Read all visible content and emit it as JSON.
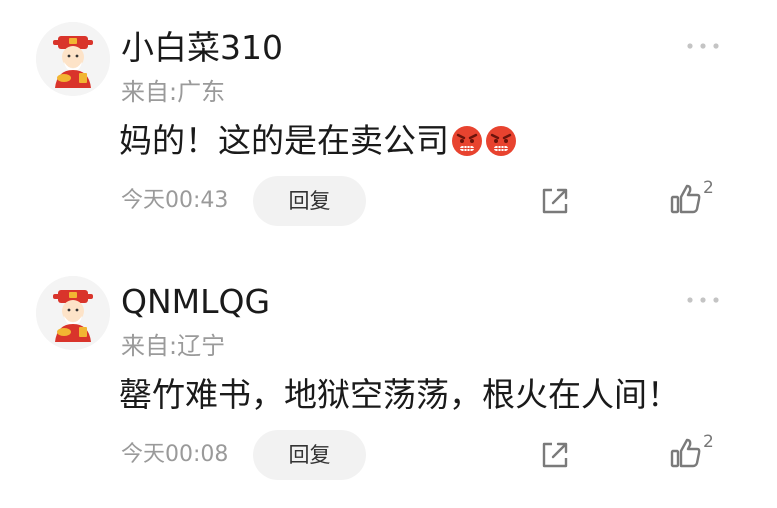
{
  "comments": [
    {
      "username": "小白菜310",
      "location": "来自:广东",
      "text": "妈的！这的是在卖公司",
      "emojis": [
        "angry-face-icon",
        "angry-face-icon"
      ],
      "time": "今天00:43",
      "reply_label": "回复",
      "like_count": "2"
    },
    {
      "username": "QNMLQG",
      "location": "来自:辽宁",
      "text": "罄竹难书，地狱空荡荡，根火在人间！",
      "emojis": [],
      "time": "今天00:08",
      "reply_label": "回复",
      "like_count": "2"
    }
  ],
  "colors": {
    "secondary_text": "#9a9a9a",
    "reply_button_bg": "#f2f2f2",
    "emoji_red": "#e8432f",
    "avatar_red": "#d9342b",
    "avatar_gold": "#f2b532"
  }
}
